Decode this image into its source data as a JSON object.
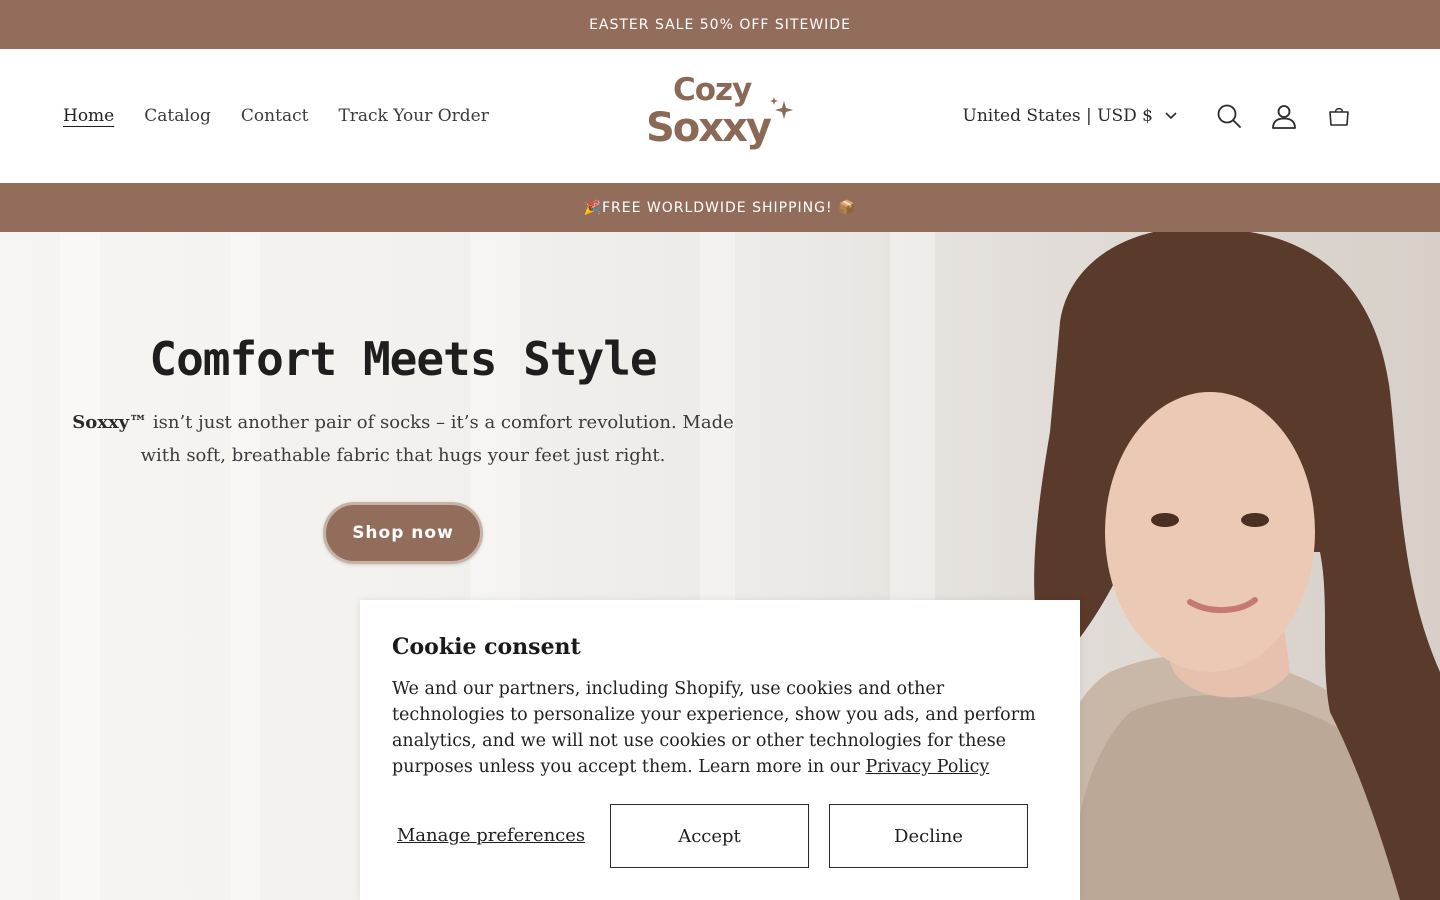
{
  "announcement": {
    "text": "EASTER SALE 50% OFF SITEWIDE"
  },
  "nav": {
    "items": [
      {
        "label": "Home",
        "active": true
      },
      {
        "label": "Catalog"
      },
      {
        "label": "Contact"
      },
      {
        "label": "Track Your Order"
      }
    ]
  },
  "logo": {
    "line1": "Cozy",
    "line2": "Soxxy"
  },
  "header_right": {
    "country_label": "United States | USD $",
    "icons": [
      "search-icon",
      "account-icon",
      "cart-icon",
      "chevron-down-icon"
    ]
  },
  "shipping_bar": {
    "text": "🎉FREE WORLDWIDE SHIPPING! 📦"
  },
  "hero": {
    "title": "Comfort Meets Style",
    "brand": "Soxxy™",
    "description": " isn’t just another pair of socks – it’s a comfort revolution. Made with soft, breathable fabric that hugs your feet just right.",
    "cta_label": "Shop now"
  },
  "cookie": {
    "title": "Cookie consent",
    "body": "We and our partners, including Shopify, use cookies and other technologies to personalize your experience, show you ads, and perform analytics, and we will not use cookies or other technologies for these purposes unless you accept them. Learn more in our ",
    "link_label": "Privacy Policy",
    "manage_label": "Manage preferences",
    "accept_label": "Accept",
    "decline_label": "Decline"
  },
  "colors": {
    "brand": "#936d5b",
    "text": "#2a2a2a",
    "background": "#ffffff"
  }
}
